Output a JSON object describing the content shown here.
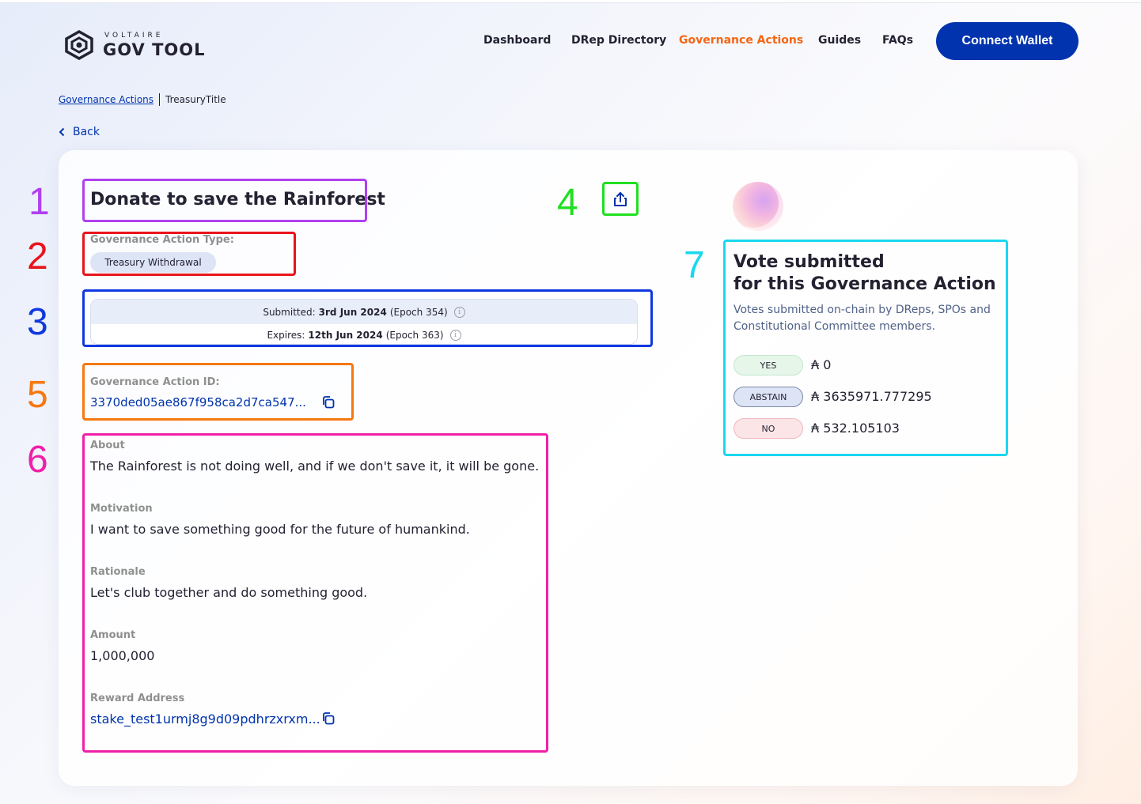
{
  "header": {
    "logo_small": "VOLTAIRE",
    "logo_big": "GOV TOOL",
    "nav": [
      {
        "label": "Dashboard",
        "active": false
      },
      {
        "label": "DRep Directory",
        "active": false
      },
      {
        "label": "Governance Actions",
        "active": true
      },
      {
        "label": "Guides",
        "active": false
      },
      {
        "label": "FAQs",
        "active": false
      }
    ],
    "connect_label": "Connect Wallet",
    "accent_color": "#f56614",
    "brand_color": "#0033ad"
  },
  "breadcrumb": {
    "link": "Governance Actions",
    "current": "TreasuryTitle"
  },
  "back_label": "Back",
  "annotations": [
    "1",
    "2",
    "3",
    "4",
    "5",
    "6",
    "7"
  ],
  "action": {
    "title": "Donate to save the Rainforest",
    "type_label": "Governance Action Type:",
    "type_value": "Treasury Withdrawal",
    "submitted_label": "Submitted:",
    "submitted_date": "3rd Jun 2024",
    "submitted_epoch": "(Epoch 354)",
    "expires_label": "Expires:",
    "expires_date": "12th Jun 2024",
    "expires_epoch": "(Epoch 363)",
    "id_label": "Governance Action ID:",
    "id_value": "3370ded05ae867f958ca2d7ca547...",
    "sections": {
      "about_label": "About",
      "about_text": "The Rainforest is not doing well, and if we don't save it, it will be gone.",
      "motivation_label": "Motivation",
      "motivation_text": "I want to save something good for the future of humankind.",
      "rationale_label": "Rationale",
      "rationale_text": "Let's club together and do something good.",
      "amount_label": "Amount",
      "amount_text": "1,000,000",
      "reward_label": "Reward Address",
      "reward_text": "stake_test1urmj8g9d09pdhrzxrxm..."
    }
  },
  "votes": {
    "title_line1": "Vote submitted",
    "title_line2": "for this Governance Action",
    "description": "Votes submitted on-chain by DReps, SPOs and Constitutional Committee members.",
    "yes_label": "YES",
    "yes_amount": "₳ 0",
    "abstain_label": "ABSTAIN",
    "abstain_amount": "₳ 3635971.777295",
    "no_label": "NO",
    "no_amount": "₳ 532.105103"
  }
}
